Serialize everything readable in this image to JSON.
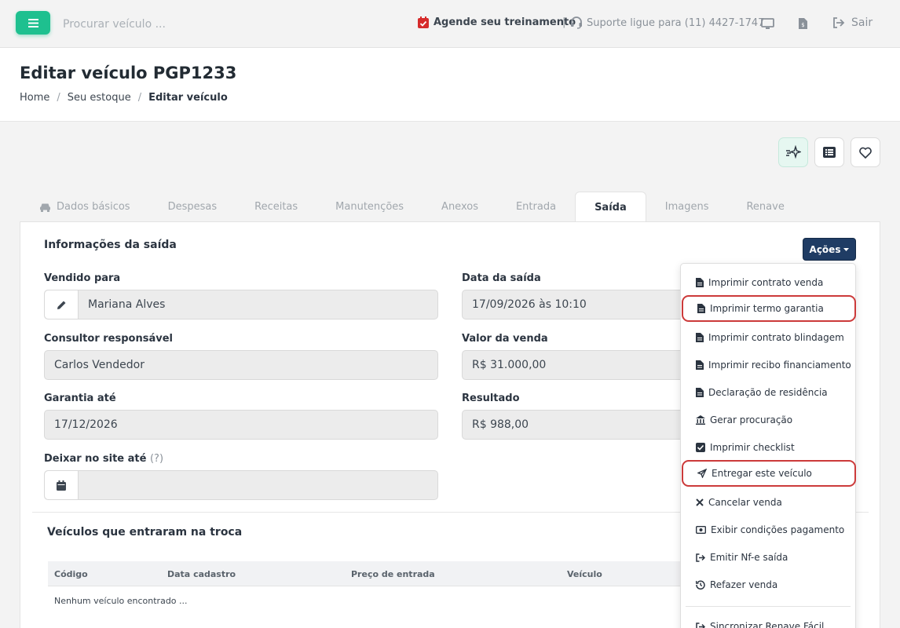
{
  "topbar": {
    "search_placeholder": "Procurar veículo ...",
    "training_label": "Agende seu treinamento",
    "separator": "|",
    "support_label": "Suporte ligue para (11) 4427-1747",
    "logout_label": "Sair"
  },
  "header": {
    "title": "Editar veículo PGP1233",
    "breadcrumb": [
      "Home",
      "Seu estoque",
      "Editar veículo"
    ],
    "breadcrumb_sep": "/"
  },
  "tabs": [
    "Dados básicos",
    "Despesas",
    "Receitas",
    "Manutenções",
    "Anexos",
    "Entrada",
    "Saída",
    "Imagens",
    "Renave"
  ],
  "active_tab": "Saída",
  "saida": {
    "section_title": "Informações da saída",
    "acoes_label": "Ações",
    "vendido_para": {
      "label": "Vendido para",
      "value": "Mariana Alves"
    },
    "data_saida": {
      "label": "Data da saída",
      "value": "17/09/2026 às 10:10"
    },
    "consultor": {
      "label": "Consultor responsável",
      "value": "Carlos Vendedor"
    },
    "valor_venda": {
      "label": "Valor da venda",
      "value": "R$ 31.000,00"
    },
    "garantia": {
      "label": "Garantia até",
      "value": "17/12/2026"
    },
    "resultado": {
      "label": "Resultado",
      "value": "R$ 988,00"
    },
    "deixar_site": {
      "label": "Deixar no site até",
      "help": "(?)",
      "value": ""
    }
  },
  "trade": {
    "title": "Veículos que entraram na troca",
    "columns": [
      "Código",
      "Data cadastro",
      "Preço de entrada",
      "Veículo"
    ],
    "empty": "Nenhum veículo encontrado ..."
  },
  "dropdown": {
    "items": [
      {
        "label": "Imprimir contrato venda",
        "icon": "file-icon"
      },
      {
        "label": "Imprimir termo garantia",
        "icon": "file-icon",
        "highlighted": true
      },
      {
        "label": "Imprimir contrato blindagem",
        "icon": "file-icon"
      },
      {
        "label": "Imprimir recibo financiamento",
        "icon": "file-icon"
      },
      {
        "label": "Declaração de residência",
        "icon": "file-icon"
      },
      {
        "label": "Gerar procuração",
        "icon": "bank-icon"
      },
      {
        "label": "Imprimir checklist",
        "icon": "checkbox-icon"
      },
      {
        "label": "Entregar este veículo",
        "icon": "paper-plane-icon",
        "highlighted": true
      },
      {
        "label": "Cancelar venda",
        "icon": "close-icon"
      },
      {
        "label": "Exibir condições pagamento",
        "icon": "money-icon"
      },
      {
        "label": "Emitir Nf-e saída",
        "icon": "sign-out-icon"
      },
      {
        "label": "Refazer venda",
        "icon": "history-icon"
      },
      {
        "label": "Sincronizar Renave Fácil",
        "icon": "sync-icon"
      }
    ]
  },
  "colors": {
    "accent": "#1ec08f",
    "primary": "#1f3c64",
    "highlight": "#cc3a3a",
    "calendar": "#d62b2b"
  }
}
